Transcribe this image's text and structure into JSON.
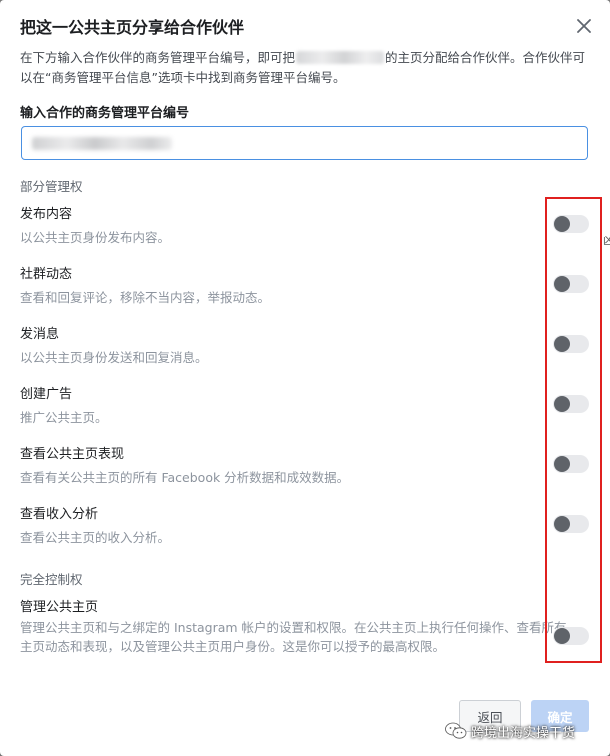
{
  "dialog": {
    "title": "把这一公共主页分享给合作伙伴",
    "intro_part1": "在下方输入合作伙伴的商务管理平台编号，即可把",
    "intro_part2": "的主页分配给合作伙伴。合作伙伴可以在“商务管理平台信息”选项卡中找到商务管理平台编号。",
    "field_label": "输入合作的商务管理平台编号"
  },
  "sections": {
    "partial": "部分管理权",
    "full": "完全控制权"
  },
  "permissions": [
    {
      "name": "发布内容",
      "desc": "以公共主页身份发布内容。",
      "enabled": false
    },
    {
      "name": "社群动态",
      "desc": "查看和回复评论，移除不当内容，举报动态。",
      "enabled": false
    },
    {
      "name": "发消息",
      "desc": "以公共主页身份发送和回复消息。",
      "enabled": false
    },
    {
      "name": "创建广告",
      "desc": "推广公共主页。",
      "enabled": false
    },
    {
      "name": "查看公共主页表现",
      "desc": "查看有关公共主页的所有 Facebook 分析数据和成效数据。",
      "enabled": false
    },
    {
      "name": "查看收入分析",
      "desc": "查看公共主页的收入分析。",
      "enabled": false
    },
    {
      "name": "管理公共主页",
      "desc": "管理公共主页和与之绑定的 Instagram 帐户的设置和权限。在公共主页上执行任何操作、查看所有主页动态和表现，以及管理公共主页用户身份。这是你可以授予的最高权限。",
      "enabled": false
    }
  ],
  "buttons": {
    "back": "返回",
    "confirm": "确定"
  },
  "watermark": "跨境出海实操干货",
  "edge_text": "凶",
  "colors": {
    "highlight": "#e0201f",
    "input_focus": "#4a90e2",
    "confirm_disabled": "#bcd3f5"
  }
}
